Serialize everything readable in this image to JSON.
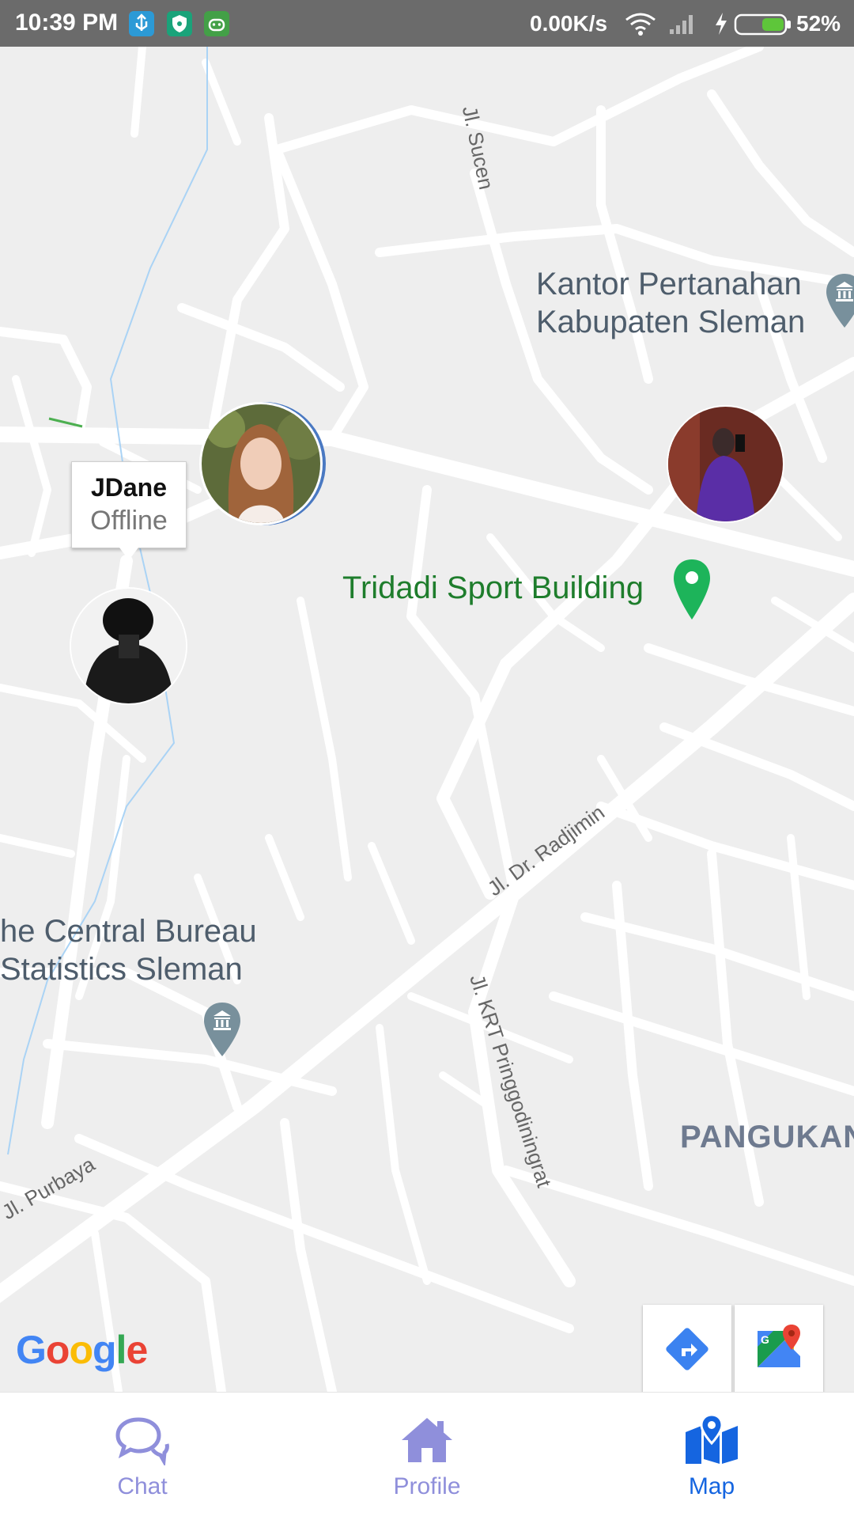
{
  "status_bar": {
    "time": "10:39 PM",
    "net_speed": "0.00K/s",
    "battery_percent": "52%",
    "icons": [
      "usb-icon",
      "vpn-shield-icon",
      "android-icon",
      "wifi-icon",
      "signal-icon",
      "charging-bolt-icon",
      "battery-icon"
    ]
  },
  "map": {
    "streets": [
      "Jl. Sucen",
      "Jl. Dr. Radjimin",
      "Jl. KRT Pringgodiningrat",
      "Jl. Purbaya"
    ],
    "pois": {
      "kantor": [
        "Kantor Pertanahan",
        "Kabupaten Sleman"
      ],
      "tridadi": "Tridadi Sport Building",
      "bureau": [
        "he Central Bureau",
        "Statistics Sleman"
      ]
    },
    "area_label": "PANGUKAN",
    "attribution": [
      "G",
      "o",
      "o",
      "g",
      "l",
      "e"
    ],
    "attribution_colors": [
      "#4285F4",
      "#EA4335",
      "#FBBC05",
      "#4285F4",
      "#34A853",
      "#EA4335"
    ]
  },
  "markers": {
    "selected_user": {
      "name": "JDane",
      "status": "Offline"
    }
  },
  "bottom_nav": {
    "items": [
      {
        "label": "Chat",
        "icon": "chat-icon"
      },
      {
        "label": "Profile",
        "icon": "home-icon"
      },
      {
        "label": "Map",
        "icon": "map-icon"
      }
    ],
    "active_color": "#1565e0",
    "inactive_color": "#8f8fdb"
  }
}
